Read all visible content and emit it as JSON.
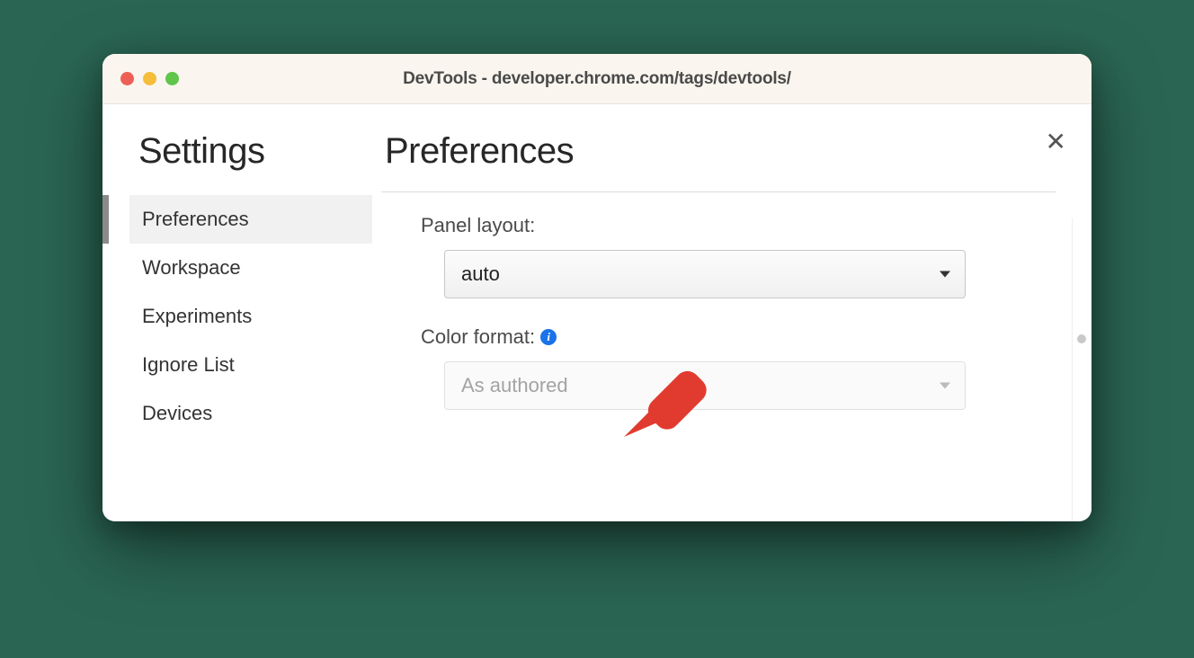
{
  "window": {
    "title": "DevTools - developer.chrome.com/tags/devtools/"
  },
  "sidebar": {
    "heading": "Settings",
    "items": [
      {
        "label": "Preferences",
        "active": true
      },
      {
        "label": "Workspace",
        "active": false
      },
      {
        "label": "Experiments",
        "active": false
      },
      {
        "label": "Ignore List",
        "active": false
      },
      {
        "label": "Devices",
        "active": false
      }
    ]
  },
  "main": {
    "heading": "Preferences",
    "fields": {
      "panel_layout": {
        "label": "Panel layout:",
        "value": "auto"
      },
      "color_format": {
        "label": "Color format:",
        "value": "As authored",
        "info_tooltip": "i"
      }
    }
  },
  "close_label": "✕"
}
